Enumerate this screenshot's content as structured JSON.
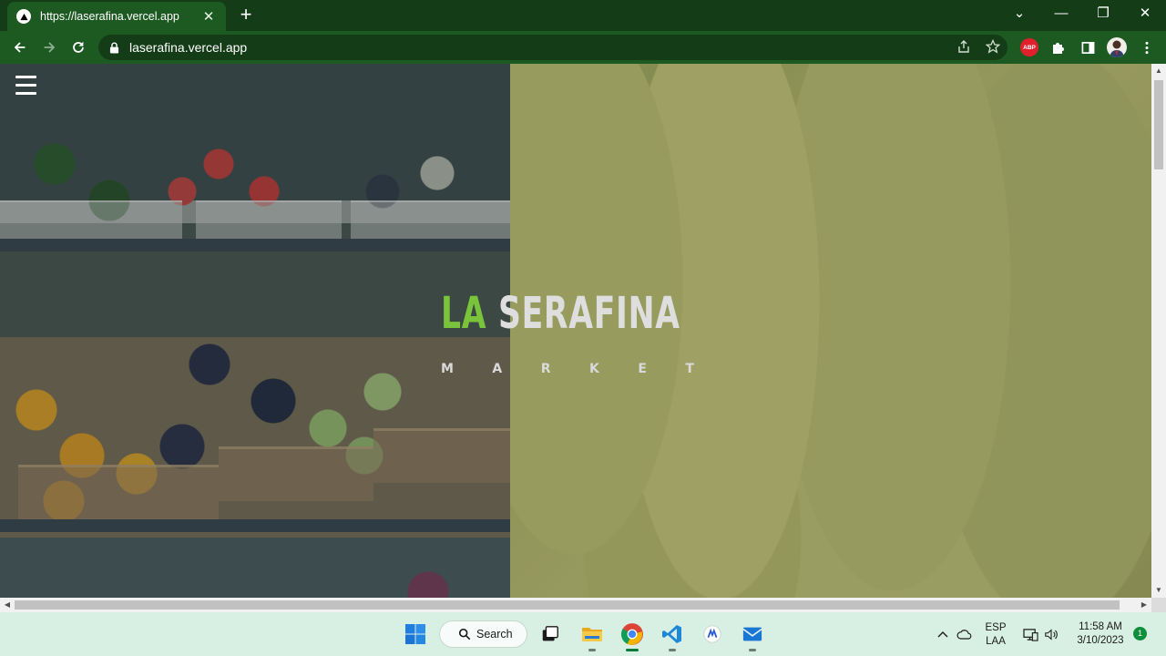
{
  "browser": {
    "tab": {
      "title": "https://laserafina.vercel.app",
      "close_glyph": "✕"
    },
    "new_tab_glyph": "+",
    "window_controls": {
      "tab_search": "⌄",
      "minimize": "—",
      "restore": "❐",
      "close": "✕"
    },
    "address": {
      "url": "laserafina.vercel.app"
    },
    "extensions": {
      "abp_label": "ABP"
    },
    "theme_colors": {
      "tabstrip": "#143d17",
      "toolbar": "#1d5a22"
    }
  },
  "page": {
    "brand": {
      "highlight": "LA",
      "rest": "SERAFINA"
    },
    "tagline_letters": [
      "M",
      "A",
      "R",
      "K",
      "E",
      "T"
    ],
    "colors": {
      "brand_accent": "#79c43b",
      "brand_text": "#dedede"
    }
  },
  "taskbar": {
    "search_label": "Search",
    "language": {
      "line1": "ESP",
      "line2": "LAA"
    },
    "clock": {
      "time": "11:58 AM",
      "date": "3/10/2023"
    },
    "notification_count": "1"
  }
}
